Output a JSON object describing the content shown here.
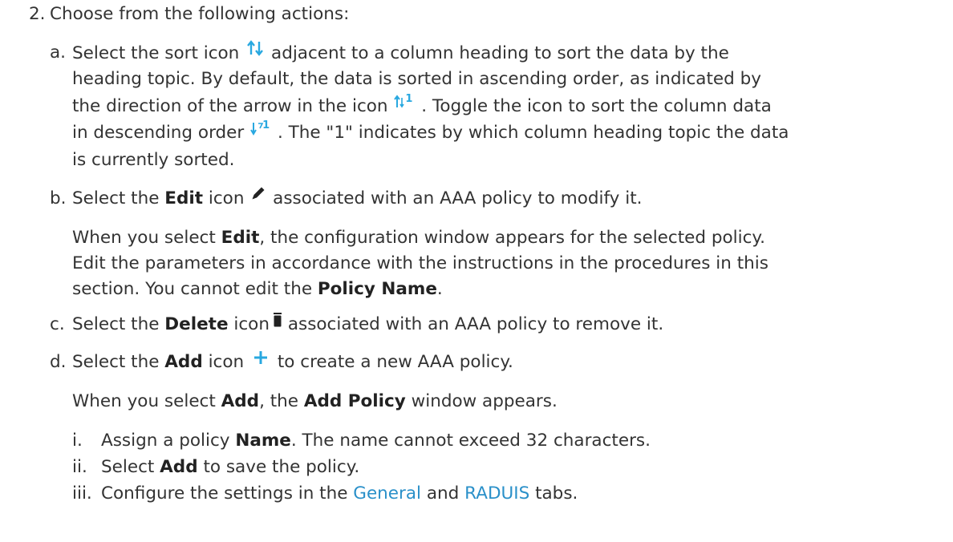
{
  "step": {
    "number": "2.",
    "text": "Choose from the following actions:"
  },
  "items": {
    "a": {
      "marker": "a.",
      "l1_before": "Select the sort icon",
      "l1_after": "adjacent to a column heading to sort the data by the",
      "l2": "heading topic. By default, the data is sorted in ascending order, as indicated by",
      "l3_before": "the direction of the arrow in the icon",
      "l3_after": ". Toggle the icon to sort the column data",
      "l4_before": "in descending order",
      "l4_after": ". The \"1\" indicates by which column heading topic the data",
      "l5": "is currently sorted.",
      "sort_badge": "1"
    },
    "b": {
      "marker": "b.",
      "l1_before": "Select the",
      "l1_bold": "Edit",
      "l1_mid": "icon",
      "l1_after": "associated with an AAA policy to modify it.",
      "p2_l1_before": "When you select",
      "p2_l1_bold": "Edit",
      "p2_l1_after": ", the configuration window appears for the selected policy.",
      "p2_l2": "Edit the parameters in accordance with the instructions in the procedures in this",
      "p2_l3_before": "section. You cannot edit the",
      "p2_l3_bold": "Policy Name",
      "p2_l3_after": "."
    },
    "c": {
      "marker": "c.",
      "before": "Select the",
      "bold": "Delete",
      "mid": "icon",
      "after": "associated with an AAA policy to remove it."
    },
    "d": {
      "marker": "d.",
      "before": "Select the",
      "bold": "Add",
      "mid": "icon",
      "after": "to create a new AAA policy.",
      "p2_before": "When you select",
      "p2_bold1": "Add",
      "p2_mid": ", the",
      "p2_bold2": "Add Policy",
      "p2_after": "window appears.",
      "sub": {
        "i": {
          "marker": "i.",
          "before": "Assign a policy",
          "bold": "Name",
          "after": ". The name cannot exceed 32 characters."
        },
        "ii": {
          "marker": "ii.",
          "before": "Select",
          "bold": "Add",
          "after": "to save the policy."
        },
        "iii": {
          "marker": "iii.",
          "before": "Configure the settings in the",
          "link1": "General",
          "mid": "and",
          "link2": "RADUIS",
          "after": "tabs."
        }
      }
    }
  },
  "colors": {
    "text": "#333333",
    "link": "#2a90c9",
    "icon_blue": "#29a8e0",
    "icon_dark": "#222222"
  },
  "icons": [
    "sort-icon",
    "sort-ascending-icon",
    "sort-descending-icon",
    "edit-pencil-icon",
    "delete-trash-icon",
    "add-plus-icon"
  ]
}
